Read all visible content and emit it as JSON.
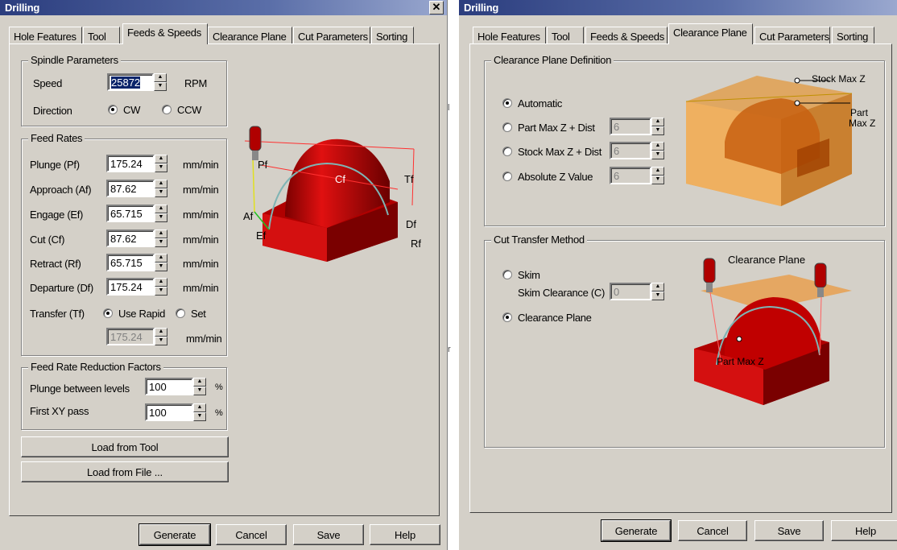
{
  "left": {
    "title": "Drilling",
    "close": "✕",
    "tabs": [
      "Hole Features",
      "Tool",
      "Feeds & Speeds",
      "Clearance Plane",
      "Cut Parameters",
      "Sorting"
    ],
    "spindle": {
      "title": "Spindle Parameters",
      "speed_label": "Speed",
      "speed_value": "25872",
      "speed_unit": "RPM",
      "direction_label": "Direction",
      "cw": "CW",
      "ccw": "CCW"
    },
    "feeds": {
      "title": "Feed Rates",
      "unit": "mm/min",
      "rows": [
        {
          "label": "Plunge (Pf)",
          "value": "175.24"
        },
        {
          "label": "Approach (Af)",
          "value": "87.62"
        },
        {
          "label": "Engage (Ef)",
          "value": "65.715"
        },
        {
          "label": "Cut (Cf)",
          "value": "87.62"
        },
        {
          "label": "Retract (Rf)",
          "value": "65.715"
        },
        {
          "label": "Departure  (Df)",
          "value": "175.24"
        }
      ],
      "transfer_label": "Transfer (Tf)",
      "use_rapid": "Use Rapid",
      "set": "Set",
      "transfer_value": "175.24",
      "transfer_unit": "mm/min"
    },
    "reduction": {
      "title": "Feed Rate Reduction Factors",
      "plunge_label": "Plunge between levels",
      "plunge_value": "100",
      "pct": "%",
      "xy_label": "First XY pass",
      "xy_value": "100"
    },
    "load_tool": "Load from Tool",
    "load_file": "Load from File ...",
    "diagram_labels": {
      "pf": "Pf",
      "cf": "Cf",
      "tf": "Tf",
      "af": "Af",
      "ef": "Ef",
      "df": "Df",
      "rf": "Rf"
    },
    "buttons": {
      "generate": "Generate",
      "cancel": "Cancel",
      "save": "Save",
      "help": "Help"
    }
  },
  "right": {
    "title": "Drilling",
    "tabs": [
      "Hole Features",
      "Tool",
      "Feeds & Speeds",
      "Clearance Plane",
      "Cut Parameters",
      "Sorting"
    ],
    "cpd": {
      "title": "Clearance Plane Definition",
      "automatic": "Automatic",
      "part_max": "Part Max Z + Dist",
      "part_max_value": "6",
      "stock_max": "Stock Max Z + Dist",
      "stock_max_value": "6",
      "absolute": "Absolute Z Value",
      "absolute_value": "6",
      "label_stock": "Stock Max Z",
      "label_part_1": "Part",
      "label_part_2": "Max Z"
    },
    "ctm": {
      "title": "Cut Transfer Method",
      "skim": "Skim",
      "skim_clearance": "Skim Clearance (C)",
      "skim_value": "0",
      "clearance_plane": "Clearance Plane",
      "label_plane": "Clearance Plane",
      "label_part": "Part Max Z"
    },
    "buttons": {
      "generate": "Generate",
      "cancel": "Cancel",
      "save": "Save",
      "help": "Help"
    }
  },
  "gap_fragments": [
    "l",
    "r"
  ]
}
